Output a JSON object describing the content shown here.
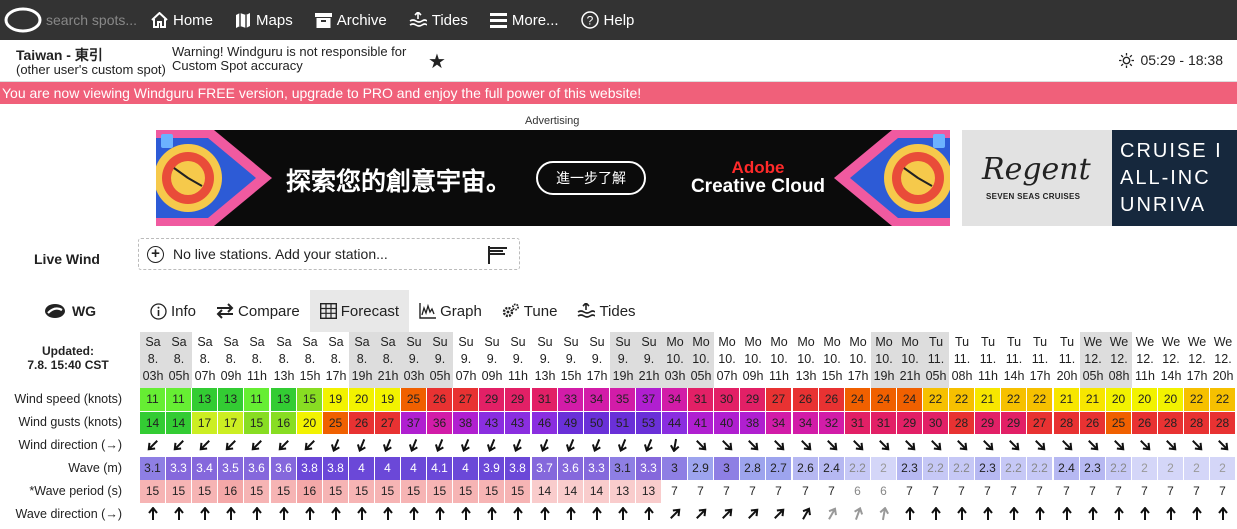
{
  "nav": {
    "search_placeholder": "search spots...",
    "items": [
      {
        "label": "Home",
        "icon": "home-icon"
      },
      {
        "label": "Maps",
        "icon": "maps-icon"
      },
      {
        "label": "Archive",
        "icon": "archive-icon"
      },
      {
        "label": "Tides",
        "icon": "tides-icon"
      },
      {
        "label": "More...",
        "icon": "menu-icon"
      },
      {
        "label": "Help",
        "icon": "help-icon"
      }
    ]
  },
  "spot": {
    "name": "Taiwan - 東引",
    "subtitle": "(other user's custom spot)",
    "warning": "Warning! Windguru is not responsible for Custom Spot accuracy",
    "star": "★",
    "sun_times": "05:29 - 18:38"
  },
  "pro_banner": "You are now viewing Windguru FREE version, upgrade to PRO and enjoy the full power of this website!",
  "ad": {
    "label": "Advertising",
    "headline": "探索您的創意宇宙。",
    "cta": "進一步了解",
    "brand1": "Adobe",
    "brand2": "Creative Cloud",
    "regent": "Regent",
    "regent_sub": "SEVEN SEAS CRUISES",
    "cruise_lines": [
      "CRUISE I",
      "ALL-INC",
      "UNRIVA"
    ]
  },
  "live_wind": {
    "label": "Live Wind",
    "message": "No live stations. Add your station..."
  },
  "tabs": {
    "logo": "WG",
    "items": [
      {
        "label": "Info",
        "icon": "info-icon"
      },
      {
        "label": "Compare",
        "icon": "compare-icon"
      },
      {
        "label": "Forecast",
        "icon": "table-icon",
        "active": true
      },
      {
        "label": "Graph",
        "icon": "graph-icon"
      },
      {
        "label": "Tune",
        "icon": "gear-icon"
      },
      {
        "label": "Tides",
        "icon": "tides-icon"
      }
    ]
  },
  "forecast": {
    "updated_label": "Updated:",
    "updated_value": "7.8. 15:40 CST",
    "row_labels": [
      "Wind speed (knots)",
      "Wind gusts (knots)",
      "Wind direction (→)",
      "Wave (m)",
      "*Wave period (s)",
      "Wave direction (→)"
    ],
    "columns": [
      {
        "day": "Sa",
        "date": "8.",
        "hour": "03h"
      },
      {
        "day": "Sa",
        "date": "8.",
        "hour": "05h"
      },
      {
        "day": "Sa",
        "date": "8.",
        "hour": "07h"
      },
      {
        "day": "Sa",
        "date": "8.",
        "hour": "09h"
      },
      {
        "day": "Sa",
        "date": "8.",
        "hour": "11h"
      },
      {
        "day": "Sa",
        "date": "8.",
        "hour": "13h"
      },
      {
        "day": "Sa",
        "date": "8.",
        "hour": "15h"
      },
      {
        "day": "Sa",
        "date": "8.",
        "hour": "17h"
      },
      {
        "day": "Sa",
        "date": "8.",
        "hour": "19h"
      },
      {
        "day": "Sa",
        "date": "8.",
        "hour": "21h"
      },
      {
        "day": "Su",
        "date": "9.",
        "hour": "03h"
      },
      {
        "day": "Su",
        "date": "9.",
        "hour": "05h"
      },
      {
        "day": "Su",
        "date": "9.",
        "hour": "07h"
      },
      {
        "day": "Su",
        "date": "9.",
        "hour": "09h"
      },
      {
        "day": "Su",
        "date": "9.",
        "hour": "11h"
      },
      {
        "day": "Su",
        "date": "9.",
        "hour": "13h"
      },
      {
        "day": "Su",
        "date": "9.",
        "hour": "15h"
      },
      {
        "day": "Su",
        "date": "9.",
        "hour": "17h"
      },
      {
        "day": "Su",
        "date": "9.",
        "hour": "19h"
      },
      {
        "day": "Su",
        "date": "9.",
        "hour": "21h"
      },
      {
        "day": "Mo",
        "date": "10.",
        "hour": "03h"
      },
      {
        "day": "Mo",
        "date": "10.",
        "hour": "05h"
      },
      {
        "day": "Mo",
        "date": "10.",
        "hour": "07h"
      },
      {
        "day": "Mo",
        "date": "10.",
        "hour": "09h"
      },
      {
        "day": "Mo",
        "date": "10.",
        "hour": "11h"
      },
      {
        "day": "Mo",
        "date": "10.",
        "hour": "13h"
      },
      {
        "day": "Mo",
        "date": "10.",
        "hour": "15h"
      },
      {
        "day": "Mo",
        "date": "10.",
        "hour": "17h"
      },
      {
        "day": "Mo",
        "date": "10.",
        "hour": "19h"
      },
      {
        "day": "Mo",
        "date": "10.",
        "hour": "21h"
      },
      {
        "day": "Tu",
        "date": "11.",
        "hour": "05h"
      },
      {
        "day": "Tu",
        "date": "11.",
        "hour": "08h"
      },
      {
        "day": "Tu",
        "date": "11.",
        "hour": "11h"
      },
      {
        "day": "Tu",
        "date": "11.",
        "hour": "14h"
      },
      {
        "day": "Tu",
        "date": "11.",
        "hour": "17h"
      },
      {
        "day": "Tu",
        "date": "11.",
        "hour": "20h"
      },
      {
        "day": "We",
        "date": "12.",
        "hour": "05h"
      },
      {
        "day": "We",
        "date": "12.",
        "hour": "08h"
      },
      {
        "day": "We",
        "date": "12.",
        "hour": "11h"
      },
      {
        "day": "We",
        "date": "12.",
        "hour": "14h"
      },
      {
        "day": "We",
        "date": "12.",
        "hour": "17h"
      },
      {
        "day": "We",
        "date": "12.",
        "hour": "20h"
      }
    ],
    "wind_speed": [
      11,
      11,
      13,
      13,
      11,
      13,
      15,
      19,
      20,
      19,
      25,
      26,
      27,
      29,
      29,
      31,
      33,
      34,
      35,
      37,
      34,
      31,
      30,
      29,
      27,
      26,
      26,
      24,
      24,
      24,
      22,
      22,
      21,
      22,
      22,
      21,
      21,
      20,
      20,
      20,
      22,
      22
    ],
    "wind_gusts": [
      14,
      14,
      17,
      17,
      15,
      16,
      20,
      25,
      26,
      27,
      37,
      36,
      38,
      43,
      43,
      46,
      49,
      50,
      51,
      53,
      44,
      41,
      40,
      38,
      34,
      34,
      32,
      31,
      31,
      29,
      30,
      28,
      29,
      29,
      27,
      28,
      26,
      25,
      26,
      28,
      28,
      28
    ],
    "wind_direction_deg": [
      135,
      135,
      135,
      135,
      135,
      135,
      135,
      112,
      112,
      112,
      112,
      112,
      112,
      112,
      112,
      112,
      112,
      112,
      112,
      112,
      100,
      45,
      45,
      45,
      45,
      45,
      45,
      45,
      45,
      45,
      45,
      45,
      45,
      45,
      45,
      45,
      45,
      45,
      45,
      45,
      45,
      45
    ],
    "wave_m": [
      "3.1",
      "3.3",
      "3.4",
      "3.5",
      "3.6",
      "3.6",
      "3.8",
      "3.8",
      "4",
      "4",
      "4",
      "4.1",
      "4",
      "3.9",
      "3.8",
      "3.7",
      "3.6",
      "3.3",
      "3.1",
      "3.3",
      "3",
      "2.9",
      "3",
      "2.8",
      "2.7",
      "2.6",
      "2.4",
      "2.2",
      "2",
      "2.3",
      "2.2",
      "2.2",
      "2.3",
      "2.2",
      "2.2",
      "2.4",
      "2.3",
      "2.2",
      "2",
      "2",
      "2",
      "2"
    ],
    "wave_period": [
      "15",
      "15",
      "15",
      "16",
      "15",
      "15",
      "16",
      "15",
      "15",
      "15",
      "15",
      "15",
      "15",
      "15",
      "15",
      "14",
      "14",
      "14",
      "13",
      "13",
      "7",
      "7",
      "7",
      "7",
      "7",
      "7",
      "7",
      "6",
      "6",
      "7",
      "7",
      "7",
      "7",
      "7",
      "7",
      "7",
      "7",
      "7",
      "7",
      "7",
      "7",
      "7"
    ],
    "wave_direction_deg": [
      270,
      270,
      270,
      270,
      270,
      270,
      270,
      270,
      270,
      270,
      270,
      270,
      270,
      270,
      270,
      270,
      270,
      270,
      270,
      270,
      45,
      45,
      45,
      45,
      45,
      30,
      30,
      20,
      10,
      0,
      0,
      0,
      0,
      0,
      0,
      0,
      0,
      0,
      0,
      0,
      0,
      0
    ]
  }
}
